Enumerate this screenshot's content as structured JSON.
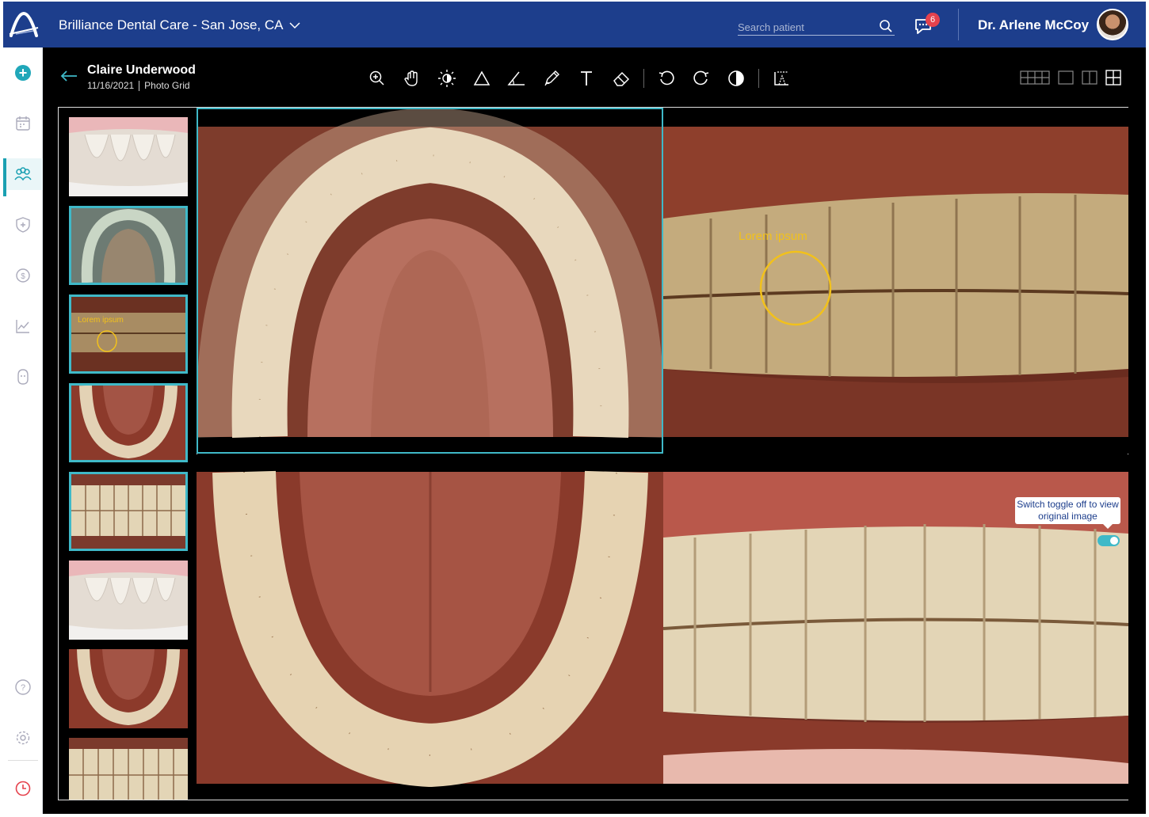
{
  "topbar": {
    "practice": "Brilliance Dental Care - San Jose, CA",
    "search_placeholder": "Search patient",
    "message_count": "6",
    "user_name": "Dr. Arlene McCoy"
  },
  "leftnav": {
    "items": [
      "calendar-icon",
      "patients-icon",
      "insurance-shield-icon",
      "billing-icon",
      "reports-chart-icon",
      "patient-profile-icon",
      "help-icon",
      "settings-icon",
      "clock-icon"
    ],
    "active": "patients-icon"
  },
  "patient": {
    "name": "Claire Underwood",
    "date": "11/16/2021",
    "view": "Photo Grid"
  },
  "toolbar": {
    "tools": [
      "zoom-in-icon",
      "pan-hand-icon",
      "brightness-icon",
      "triangle-icon",
      "angle-icon",
      "pen-icon",
      "text-icon",
      "eraser-icon",
      "undo-icon",
      "redo-icon",
      "contrast-icon",
      "measure-icon"
    ],
    "layouts": [
      "layout-six-grid-icon",
      "layout-single-icon",
      "layout-two-column-icon",
      "layout-four-grid-icon"
    ]
  },
  "annotation": {
    "label": "Lorem ipsum",
    "color": "#f2c11b"
  },
  "tooltip": {
    "text": "Switch toggle off to view original image"
  },
  "colors": {
    "brand": "#1d3e8c",
    "accent": "#3fb9c8",
    "badge": "#e5424d"
  }
}
